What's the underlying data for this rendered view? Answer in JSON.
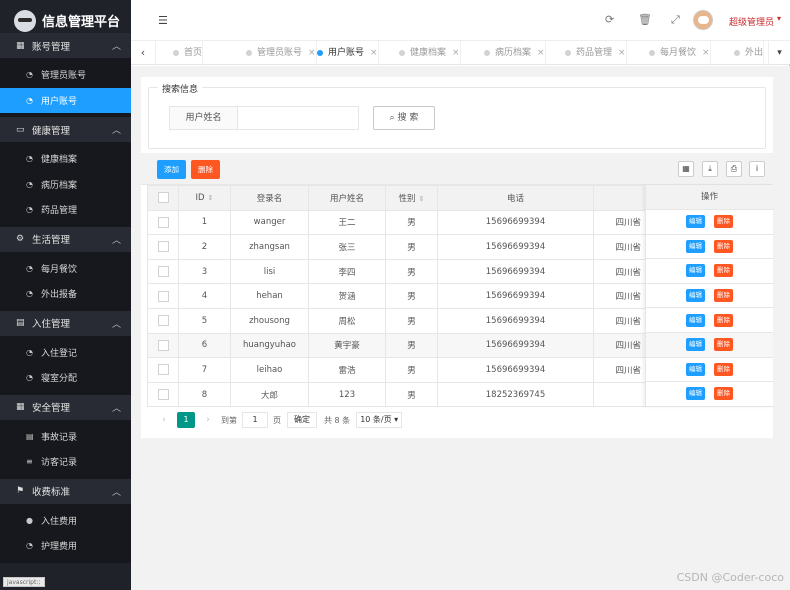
{
  "app": {
    "title": "信息管理平台"
  },
  "sidebar": {
    "groups": [
      {
        "label": "账号管理",
        "icon": "grid-icon",
        "items": [
          {
            "label": "管理员账号",
            "icon": "dashboard-icon",
            "active": false
          },
          {
            "label": "用户账号",
            "icon": "dashboard-icon",
            "active": true
          }
        ]
      },
      {
        "label": "健康管理",
        "icon": "monitor-icon",
        "items": [
          {
            "label": "健康档案",
            "icon": "dashboard-icon"
          },
          {
            "label": "病历档案",
            "icon": "dashboard-icon"
          },
          {
            "label": "药品管理",
            "icon": "dashboard-icon"
          }
        ]
      },
      {
        "label": "生活管理",
        "icon": "gears-icon",
        "items": [
          {
            "label": "每月餐饮",
            "icon": "dashboard-icon"
          },
          {
            "label": "外出报备",
            "icon": "dashboard-icon"
          }
        ]
      },
      {
        "label": "入住管理",
        "icon": "file-icon",
        "items": [
          {
            "label": "入住登记",
            "icon": "dashboard-icon"
          },
          {
            "label": "寝室分配",
            "icon": "dashboard-icon"
          }
        ]
      },
      {
        "label": "安全管理",
        "icon": "calendar-icon",
        "items": [
          {
            "label": "事故记录",
            "icon": "list-icon"
          },
          {
            "label": "访客记录",
            "icon": "bars-icon"
          }
        ]
      },
      {
        "label": "收费标准",
        "icon": "flag-icon",
        "items": [
          {
            "label": "入住费用",
            "icon": "circle-icon"
          },
          {
            "label": "护理费用",
            "icon": "dashboard-icon"
          }
        ]
      }
    ]
  },
  "topbar": {
    "user": "超级管理员"
  },
  "tabs": [
    {
      "label": "首页",
      "closable": false,
      "active": false
    },
    {
      "label": "管理员账号",
      "closable": true,
      "active": false
    },
    {
      "label": "用户账号",
      "closable": true,
      "active": true
    },
    {
      "label": "健康档案",
      "closable": true,
      "active": false
    },
    {
      "label": "病历档案",
      "closable": true,
      "active": false
    },
    {
      "label": "药品管理",
      "closable": true,
      "active": false
    },
    {
      "label": "每月餐饮",
      "closable": true,
      "active": false
    },
    {
      "label": "外出",
      "closable": false,
      "active": false
    }
  ],
  "search": {
    "legend": "搜索信息",
    "field_label": "用户姓名",
    "button_label": "搜 索"
  },
  "table": {
    "add_label": "添加",
    "delete_label": "删除",
    "columns": [
      "ID",
      "登录名",
      "用户姓名",
      "性别",
      "电话",
      "",
      "操作"
    ],
    "ops_edit": "编辑",
    "ops_delete": "删除",
    "rows": [
      {
        "id": "1",
        "login": "wanger",
        "name": "王二",
        "gender": "男",
        "phone": "15696699394",
        "extra": "四川省"
      },
      {
        "id": "2",
        "login": "zhangsan",
        "name": "张三",
        "gender": "男",
        "phone": "15696699394",
        "extra": "四川省"
      },
      {
        "id": "3",
        "login": "lisi",
        "name": "李四",
        "gender": "男",
        "phone": "15696699394",
        "extra": "四川省"
      },
      {
        "id": "4",
        "login": "hehan",
        "name": "贺涵",
        "gender": "男",
        "phone": "15696699394",
        "extra": "四川省"
      },
      {
        "id": "5",
        "login": "zhousong",
        "name": "周松",
        "gender": "男",
        "phone": "15696699394",
        "extra": "四川省"
      },
      {
        "id": "6",
        "login": "huangyuhao",
        "name": "黄宇豪",
        "gender": "男",
        "phone": "15696699394",
        "extra": "四川省"
      },
      {
        "id": "7",
        "login": "leihao",
        "name": "雷浩",
        "gender": "男",
        "phone": "15696699394",
        "extra": "四川省"
      },
      {
        "id": "8",
        "login": "大郎",
        "name": "123",
        "gender": "男",
        "phone": "18252369745",
        "extra": ""
      }
    ]
  },
  "pager": {
    "current": "1",
    "goto_label": "到第",
    "goto_value": "1",
    "page_label": "页",
    "ok_label": "确定",
    "total": "共 8 条",
    "size": "10 条/页"
  },
  "statusbar": "javascript:;",
  "watermark": "CSDN @Coder-coco"
}
